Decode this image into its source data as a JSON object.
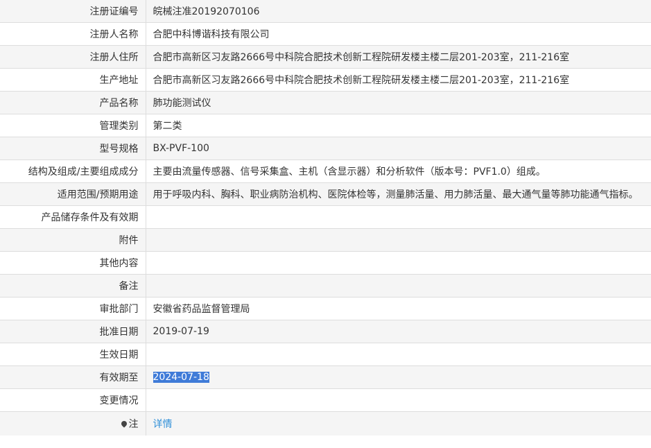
{
  "rows": [
    {
      "label": "注册证编号",
      "value": "皖械注准20192070106"
    },
    {
      "label": "注册人名称",
      "value": "合肥中科博谐科技有限公司"
    },
    {
      "label": "注册人住所",
      "value": "合肥市高新区习友路2666号中科院合肥技术创新工程院研发楼主楼二层201-203室，211-216室"
    },
    {
      "label": "生产地址",
      "value": "合肥市高新区习友路2666号中科院合肥技术创新工程院研发楼主楼二层201-203室，211-216室"
    },
    {
      "label": "产品名称",
      "value": "肺功能测试仪"
    },
    {
      "label": "管理类别",
      "value": "第二类"
    },
    {
      "label": "型号规格",
      "value": "BX-PVF-100"
    },
    {
      "label": "结构及组成/主要组成成分",
      "value": "主要由流量传感器、信号采集盒、主机（含显示器）和分析软件（版本号：PVF1.0）组成。"
    },
    {
      "label": "适用范围/预期用途",
      "value": "用于呼吸内科、胸科、职业病防治机构、医院体检等，测量肺活量、用力肺活量、最大通气量等肺功能通气指标。"
    },
    {
      "label": "产品储存条件及有效期",
      "value": ""
    },
    {
      "label": "附件",
      "value": ""
    },
    {
      "label": "其他内容",
      "value": ""
    },
    {
      "label": "备注",
      "value": ""
    },
    {
      "label": "审批部门",
      "value": "安徽省药品监督管理局"
    },
    {
      "label": "批准日期",
      "value": "2019-07-19"
    },
    {
      "label": "生效日期",
      "value": ""
    },
    {
      "label": "有效期至",
      "value": "2024-07-18"
    },
    {
      "label": "变更情况",
      "value": ""
    }
  ],
  "note": {
    "icon": "pin-icon",
    "label": "注",
    "link_text": "详情",
    "link_color": "#2f8fd8"
  },
  "colors": {
    "row_shade": "#f5f5f5",
    "border": "#dddddd",
    "selection": "#3f7bd8"
  }
}
